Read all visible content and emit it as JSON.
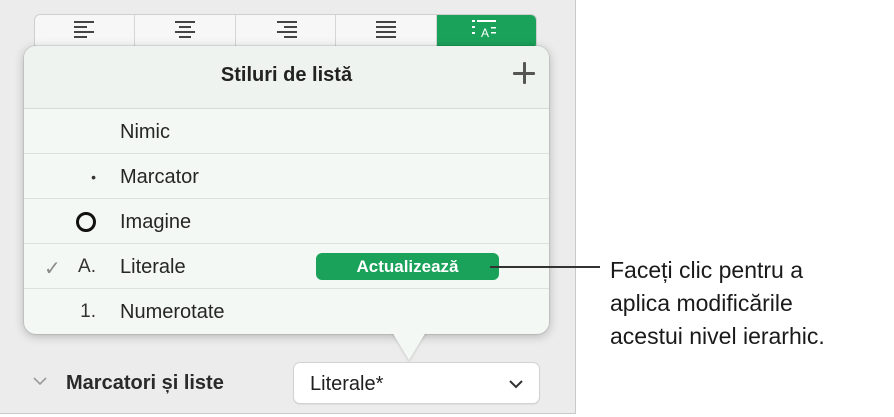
{
  "popover": {
    "title": "Stiluri de listă",
    "rows": [
      {
        "marker": "",
        "label": "Nimic"
      },
      {
        "marker": "•",
        "label": "Marcator"
      },
      {
        "marker": "",
        "label": "Imagine"
      },
      {
        "marker": "A.",
        "label": "Literale",
        "checked": true,
        "check": "✓"
      },
      {
        "marker": "1.",
        "label": "Numerotate"
      }
    ],
    "update_button": "Actualizează"
  },
  "section": {
    "title": "Marcatori și liste",
    "select_value": "Literale*"
  },
  "callout": {
    "lines": [
      "Faceți clic pentru a",
      "aplica modificările",
      "acestui nivel ierarhic."
    ]
  },
  "colors": {
    "accent": "#1ba25a",
    "popover_bg": "#f4f8f5",
    "panel_bg": "#ececec"
  }
}
